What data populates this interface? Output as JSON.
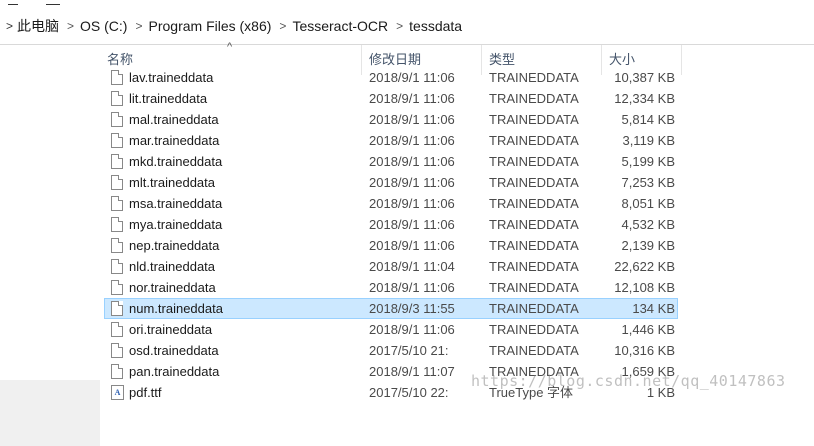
{
  "address_bar": {
    "breadcrumbs": [
      "此电脑",
      "OS (C:)",
      "Program Files (x86)",
      "Tesseract-OCR",
      "tessdata"
    ],
    "separator_icon": "chevron-right-icon"
  },
  "columns": {
    "name": "名称",
    "date": "修改日期",
    "type": "类型",
    "size": "大小"
  },
  "files": [
    {
      "name": "lav.traineddata",
      "date": "2018/9/1 11:06",
      "type": "TRAINEDDATA",
      "size": "10,387 KB",
      "icon": "file-icon"
    },
    {
      "name": "lit.traineddata",
      "date": "2018/9/1 11:06",
      "type": "TRAINEDDATA",
      "size": "12,334 KB",
      "icon": "file-icon"
    },
    {
      "name": "mal.traineddata",
      "date": "2018/9/1 11:06",
      "type": "TRAINEDDATA",
      "size": "5,814 KB",
      "icon": "file-icon"
    },
    {
      "name": "mar.traineddata",
      "date": "2018/9/1 11:06",
      "type": "TRAINEDDATA",
      "size": "3,119 KB",
      "icon": "file-icon"
    },
    {
      "name": "mkd.traineddata",
      "date": "2018/9/1 11:06",
      "type": "TRAINEDDATA",
      "size": "5,199 KB",
      "icon": "file-icon"
    },
    {
      "name": "mlt.traineddata",
      "date": "2018/9/1 11:06",
      "type": "TRAINEDDATA",
      "size": "7,253 KB",
      "icon": "file-icon"
    },
    {
      "name": "msa.traineddata",
      "date": "2018/9/1 11:06",
      "type": "TRAINEDDATA",
      "size": "8,051 KB",
      "icon": "file-icon"
    },
    {
      "name": "mya.traineddata",
      "date": "2018/9/1 11:06",
      "type": "TRAINEDDATA",
      "size": "4,532 KB",
      "icon": "file-icon"
    },
    {
      "name": "nep.traineddata",
      "date": "2018/9/1 11:06",
      "type": "TRAINEDDATA",
      "size": "2,139 KB",
      "icon": "file-icon"
    },
    {
      "name": "nld.traineddata",
      "date": "2018/9/1 11:04",
      "type": "TRAINEDDATA",
      "size": "22,622 KB",
      "icon": "file-icon"
    },
    {
      "name": "nor.traineddata",
      "date": "2018/9/1 11:06",
      "type": "TRAINEDDATA",
      "size": "12,108 KB",
      "icon": "file-icon"
    },
    {
      "name": "num.traineddata",
      "date": "2018/9/3 11:55",
      "type": "TRAINEDDATA",
      "size": "134 KB",
      "icon": "file-icon",
      "selected": true
    },
    {
      "name": "ori.traineddata",
      "date": "2018/9/1 11:06",
      "type": "TRAINEDDATA",
      "size": "1,446 KB",
      "icon": "file-icon"
    },
    {
      "name": "osd.traineddata",
      "date": "2017/5/10 21:",
      "type": "TRAINEDDATA",
      "size": "10,316 KB",
      "icon": "file-icon"
    },
    {
      "name": "pan.traineddata",
      "date": "2018/9/1 11:07",
      "type": "TRAINEDDATA",
      "size": "1,659 KB",
      "icon": "file-icon"
    },
    {
      "name": "pdf.ttf",
      "date": "2017/5/10 22:",
      "type": "TrueType 字体",
      "size": "1 KB",
      "icon": "font-file-icon"
    }
  ],
  "watermark": "https://blog.csdn.net/qq_40147863",
  "colors": {
    "selection_bg": "#cce8ff",
    "selection_border": "#99d1ff",
    "header_text": "#44546a"
  }
}
